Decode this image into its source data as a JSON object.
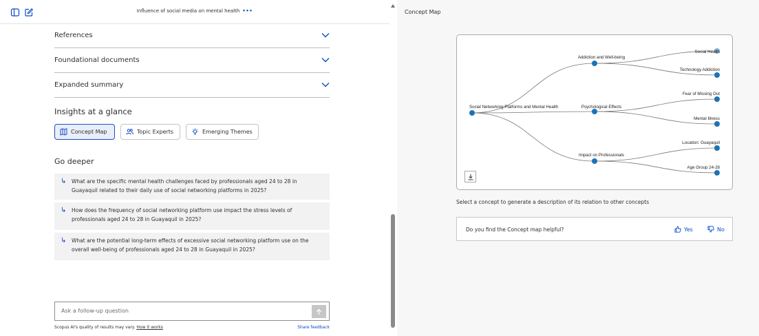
{
  "header": {
    "title": "Influence of social media on mental health",
    "more_glyph": "•••"
  },
  "accordions": [
    {
      "label": "References"
    },
    {
      "label": "Foundational documents"
    },
    {
      "label": "Expanded summary"
    }
  ],
  "insights": {
    "heading": "Insights at a glance",
    "pills": [
      {
        "label": "Concept Map",
        "icon": "map-icon",
        "active": true
      },
      {
        "label": "Topic Experts",
        "icon": "people-icon",
        "active": false
      },
      {
        "label": "Emerging Themes",
        "icon": "lightbulb-icon",
        "active": false
      }
    ]
  },
  "go_deeper": {
    "heading": "Go deeper",
    "questions": [
      "What are the specific mental health challenges faced by professionals aged 24 to 28 in Guayaquil related to their daily use of social networking platforms in 2025?",
      "How does the frequency of social networking platform use impact the stress levels of professionals aged 24 to 28 in Guayaquil in 2025?",
      "What are the potential long-term effects of excessive social networking platform use on the overall well-being of professionals aged 24 to 28 in Guayaquil in 2025?"
    ]
  },
  "ask": {
    "placeholder": "Ask a follow-up question"
  },
  "footer": {
    "disclaimer": "Scopus AI's quality of results may vary.",
    "how_it_works": "How it works",
    "share_feedback": "Share feedback"
  },
  "concept_map": {
    "panel_title": "Concept Map",
    "root": "Social Networking Platforms and Mental Health",
    "branches": [
      {
        "label": "Addiction and Well-being",
        "leaves": [
          "Social Health",
          "Technology Addiction"
        ]
      },
      {
        "label": "Psychological Effects",
        "leaves": [
          "Fear of Missing Out",
          "Mental Illness"
        ]
      },
      {
        "label": "Impact on Professionals",
        "leaves": [
          "Location: Guayaquil",
          "Age Group 24-28"
        ]
      }
    ],
    "node_color": "#1a73b8",
    "select_note": "Select a concept to generate a description of its relation to other concepts"
  },
  "feedback": {
    "question": "Do you find the Concept map helpful?",
    "yes": "Yes",
    "no": "No"
  },
  "colors": {
    "accent": "#0a49c7",
    "active_pill_border": "#1a4fc4"
  }
}
